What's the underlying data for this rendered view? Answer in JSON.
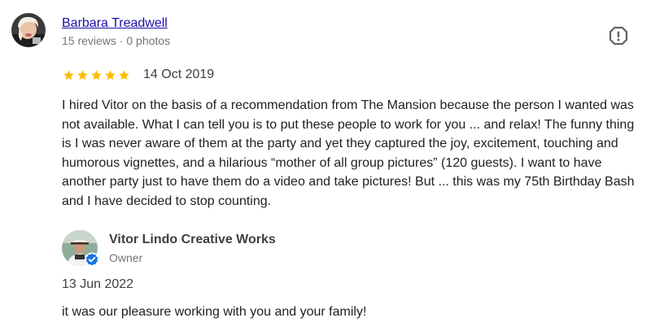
{
  "reviewer": {
    "name": "Barbara Treadwell",
    "meta": "15 reviews · 0 photos"
  },
  "review": {
    "rating": 5,
    "max_rating": 5,
    "date": "14 Oct 2019",
    "text": "I hired Vitor on the basis of a recommendation from The Mansion because the person I wanted was not available. What I can tell you is to put these people to work for you ... and relax! The funny thing is I was never aware of them at the party and yet they captured the joy, excitement, touching and humorous vignettes, and a hilarious “mother of all group pictures” (120 guests). I want to have another party just to have them do a video and take pictures! But ... this was my 75th Birthday Bash and I have decided to stop counting."
  },
  "owner_reply": {
    "name": "Vitor Lindo Creative Works",
    "role": "Owner",
    "date": "13 Jun 2022",
    "text": "it was our pleasure working with you and your family!"
  },
  "icons": {
    "flag": "report-review-icon",
    "star": "star-icon",
    "verified": "verified-badge-icon"
  },
  "colors": {
    "link": "#1a0dab",
    "star": "#fbbc04",
    "verified": "#1a73e8",
    "muted": "#70757a"
  }
}
